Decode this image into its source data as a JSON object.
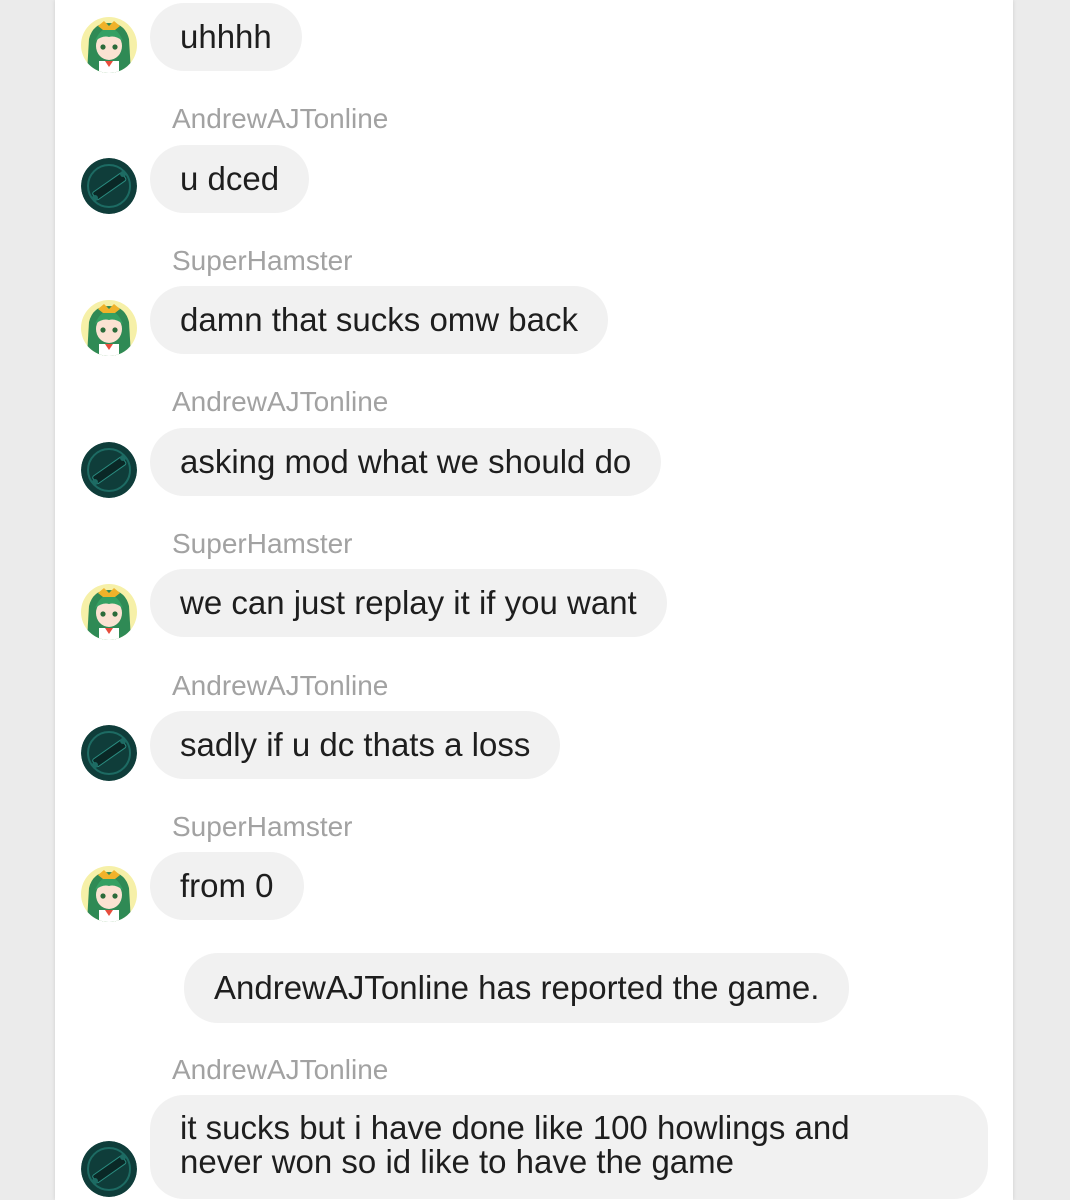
{
  "users": {
    "a": {
      "name": "AndrewAJTonline",
      "avatar_icon": "dark-teal-logo-avatar-icon",
      "avatar_color": "#0f3d3a"
    },
    "b": {
      "name": "SuperHamster",
      "avatar_icon": "anime-girl-green-hair-avatar-icon",
      "avatar_color": "#f6f0a8"
    }
  },
  "messages": [
    {
      "sender": "SuperHamster",
      "text": "uhhhh"
    },
    {
      "sender": "AndrewAJTonline",
      "text": "u dced"
    },
    {
      "sender": "SuperHamster",
      "text": "damn that sucks omw back"
    },
    {
      "sender": "AndrewAJTonline",
      "text": "asking mod what we should do"
    },
    {
      "sender": "SuperHamster",
      "text": "we can just replay it if you want"
    },
    {
      "sender": "AndrewAJTonline",
      "text": "sadly if u dc thats a loss"
    },
    {
      "sender": "SuperHamster",
      "text": "from 0"
    },
    {
      "sender": "system",
      "text": "AndrewAJTonline has reported the game."
    },
    {
      "sender": "AndrewAJTonline",
      "text_line1": "it sucks but i have done like 100 howlings and",
      "text_line2": "never won so id like to have the game"
    }
  ]
}
